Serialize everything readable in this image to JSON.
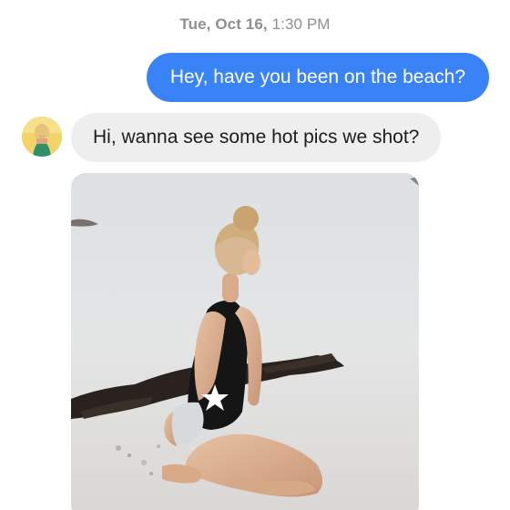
{
  "conversation": {
    "timestamp": {
      "day": "Tue, Oct 16,",
      "time": "1:30 PM"
    },
    "messages": [
      {
        "direction": "outgoing",
        "text": "Hey, have you been on the beach?"
      },
      {
        "direction": "incoming",
        "text": "Hi, wanna see some hot pics we shot?"
      }
    ],
    "attachment": {
      "type": "photo",
      "subject": "woman in black one-piece swimsuit with white star kneeling on sand"
    }
  },
  "colors": {
    "outgoing_bubble": "#3a83f7",
    "incoming_bubble": "#eeeeef",
    "timestamp_text": "#8e8e93"
  }
}
